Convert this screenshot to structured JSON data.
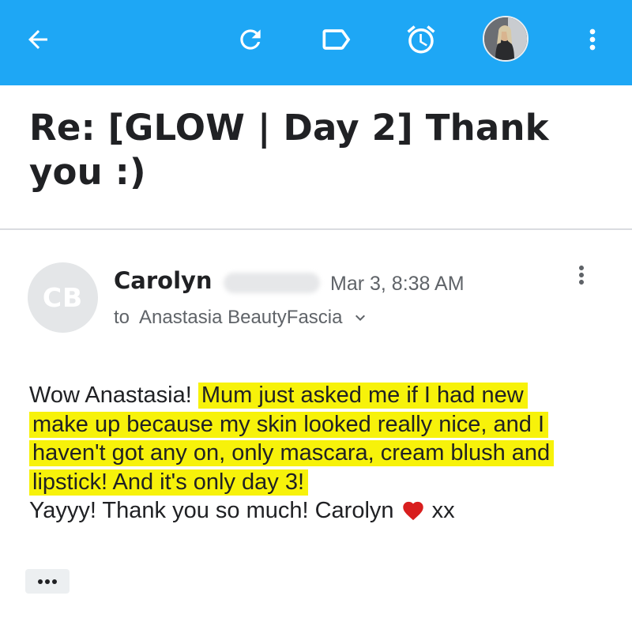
{
  "appbar": {
    "background": "#1ea7f5",
    "icons": [
      "arrow-back-icon",
      "refresh-icon",
      "label-icon",
      "alarm-clock-icon",
      "account-avatar",
      "more-vert-icon"
    ]
  },
  "email": {
    "subject": "Re: [GLOW | Day 2] Thank you :)",
    "sender_initials": "CB",
    "sender_name": "Carolyn",
    "date": "Mar 3, 8:38 AM",
    "to_label": "to",
    "recipient": "Anastasia BeautyFascia",
    "body_before": "Wow Anastasia! ",
    "body_highlight": "Mum just asked me if I had new make up because my skin looked really nice, and I haven't got any on, only mascara, cream blush and lipstick! And it's only day 3!",
    "body_after": "Yayyy! Thank you so much! Carolyn",
    "body_emoji": "❤️",
    "body_signoff": " xx",
    "highlight_color": "#f7f20a",
    "show_trimmed_label": "•••"
  }
}
